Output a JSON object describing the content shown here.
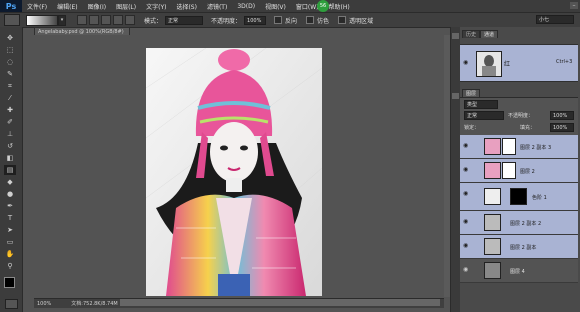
{
  "app": {
    "logo": "Ps",
    "notification_badge": "56"
  },
  "menu": [
    "文件(F)",
    "编辑(E)",
    "图像(I)",
    "图层(L)",
    "文字(Y)",
    "选择(S)",
    "滤镜(T)",
    "3D(D)",
    "视图(V)",
    "窗口(W)",
    "帮助(H)"
  ],
  "options_bar": {
    "mode_label": "模式：",
    "mode_value": "正常",
    "opacity_label": "不透明度：",
    "opacity_value": "100%",
    "reverse_label": "反向",
    "dither_label": "仿色",
    "transparency_label": "透明区域",
    "workspace": "小七"
  },
  "document": {
    "tab_title": "Angelababy.psd @ 100%(RGB/8#)",
    "zoom": "100%",
    "doc_size": "文档:752.8K/8.74M"
  },
  "history_panel": {
    "tabs": [
      "历史",
      "通道"
    ],
    "item_name": "红",
    "item_shortcut": "Ctrl+3"
  },
  "layers_panel": {
    "tab": "图层",
    "filter": "类型",
    "blend_mode": "正常",
    "opacity_label": "不透明度：",
    "opacity_value": "100%",
    "lock_label": "锁定：",
    "fill_label": "填充：",
    "fill_value": "100%",
    "layers": [
      {
        "name": "图层 2 副本 3",
        "selected": true
      },
      {
        "name": "图层 2",
        "selected": true
      },
      {
        "name": "色阶 1",
        "selected": true
      },
      {
        "name": "图层 2 副本 2",
        "selected": true
      },
      {
        "name": "图层 2 副本",
        "selected": true
      },
      {
        "name": "图层 4",
        "selected": false
      }
    ]
  }
}
